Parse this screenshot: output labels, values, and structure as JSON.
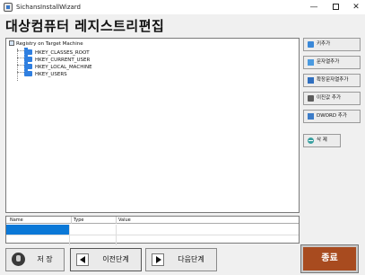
{
  "window": {
    "title": "SichansInstallWizard",
    "controls": {
      "minimize": "—",
      "close": "✕"
    }
  },
  "page_title": "대상컴퓨터 레지스트리편집",
  "tree": {
    "root_label": "Registry on Target Machine",
    "items": [
      {
        "label": "HKEY_CLASSES_ROOT"
      },
      {
        "label": "HKEY_CURRENT_USER"
      },
      {
        "label": "HKEY_LOCAL_MACHINE"
      },
      {
        "label": "HKEY_USERS"
      }
    ]
  },
  "side_buttons": {
    "add_key": {
      "label": "키추가",
      "icon": "key-icon"
    },
    "add_string": {
      "label": "문자열추가",
      "icon": "string-value-icon"
    },
    "add_expand_string": {
      "label": "확장문자열추가",
      "icon": "expand-string-icon"
    },
    "add_binary": {
      "label": "이진값 추가",
      "icon": "binary-value-icon"
    },
    "add_dword": {
      "label": "DWORD 추가",
      "icon": "dword-value-icon"
    },
    "delete": {
      "label": "삭   제",
      "icon": "delete-icon"
    }
  },
  "values_grid": {
    "columns": [
      "Name",
      "Type",
      "Value"
    ]
  },
  "bottom": {
    "save_label": "저  장",
    "prev_label": "이전단계",
    "next_label": "다음단계",
    "finish_label": "종료"
  },
  "colors": {
    "finish_button": "#a84b1f",
    "folder": "#2f7fe0",
    "selection": "#0a78d7"
  }
}
